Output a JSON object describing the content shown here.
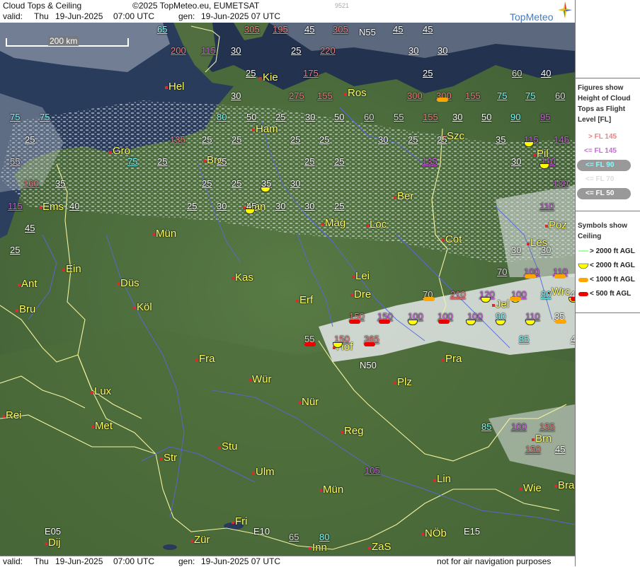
{
  "header": {
    "title": "Cloud Tops & Ceiling",
    "copyright": "©2025 TopMeteo.eu, EUMETSAT",
    "image_code": "9521",
    "valid_label": "valid:",
    "valid_day": "Thu",
    "valid_date": "19-Jun-2025",
    "valid_time": "07:00 UTC",
    "gen_label": "gen:",
    "gen_value": "19-Jun-2025 07 UTC",
    "logo_text": "TopMeteo"
  },
  "footer": {
    "valid_label": "valid:",
    "valid_day": "Thu",
    "valid_date": "19-Jun-2025",
    "valid_time": "07:00 UTC",
    "gen_label": "gen:",
    "gen_value": "19-Jun-2025 07 UTC",
    "disclaimer": "not for air navigation purposes"
  },
  "scale_bar": {
    "label": "200 km"
  },
  "legend": {
    "tops_title": "Figures show Height of Cloud Tops as Flight Level  [FL]",
    "tops_items": [
      {
        "label": "> FL 145",
        "color": "#f08080"
      },
      {
        "label": "<= FL 145",
        "color": "#cc66dd"
      },
      {
        "label": "<= FL 90",
        "color": "#80ffff"
      },
      {
        "label": "<= FL 70",
        "color": "#dddddd"
      },
      {
        "label": "<= FL 50",
        "color": "#ffffff"
      }
    ],
    "ceiling_title": "Symbols show Ceiling",
    "ceiling_items": [
      {
        "label": "> 2000 ft AGL",
        "color": "#88ff88",
        "shape": "line"
      },
      {
        "label": "< 2000 ft AGL",
        "color": "#ffff00",
        "shape": "half-circle"
      },
      {
        "label": "< 1000 ft AGL",
        "color": "#ffa500",
        "shape": "pill"
      },
      {
        "label": "< 500 ft AGL",
        "color": "#ee0000",
        "shape": "pill"
      }
    ]
  },
  "map": {
    "icon": "satellite-map",
    "cities": [
      "Hel",
      "Kie",
      "Ros",
      "Ham",
      "Gro",
      "Bre",
      "Szc",
      "Pil",
      "Ems",
      "Han",
      "Ber",
      "Poz",
      "Mag",
      "Loc",
      "Mün",
      "Cot",
      "Les",
      "Ein",
      "Kas",
      "Lei",
      "Ant",
      "Düs",
      "Dre",
      "Wrc",
      "Köl",
      "Erf",
      "Jel",
      "Bru",
      "Hof",
      "Pra",
      "Fra",
      "Lux",
      "Wür",
      "Plz",
      "Nür",
      "Rei",
      "Met",
      "Reg",
      "Brn",
      "Stu",
      "Str",
      "Ulm",
      "Lin",
      "Mün",
      "Wie",
      "Bra",
      "Fri",
      "Dij",
      "Zür",
      "Inn",
      "ZaS",
      "NÖb"
    ],
    "grid_labels": [
      "N55",
      "N50",
      "E05",
      "E10",
      "E15"
    ],
    "cloud_tops": [
      {
        "v": "65",
        "c": "#80ffff"
      },
      {
        "v": "305",
        "c": "#f08080"
      },
      {
        "v": "195",
        "c": "#f08080"
      },
      {
        "v": "45",
        "c": "#ffffff"
      },
      {
        "v": "305",
        "c": "#f08080"
      },
      {
        "v": "45",
        "c": "#ffffff"
      },
      {
        "v": "45",
        "c": "#ffffff"
      },
      {
        "v": "200",
        "c": "#f08080"
      },
      {
        "v": "115",
        "c": "#cc66dd"
      },
      {
        "v": "30",
        "c": "#ffffff"
      },
      {
        "v": "25",
        "c": "#ffffff"
      },
      {
        "v": "220",
        "c": "#f08080"
      },
      {
        "v": "30",
        "c": "#ffffff"
      },
      {
        "v": "30",
        "c": "#ffffff"
      },
      {
        "v": "25",
        "c": "#ffffff"
      },
      {
        "v": "175",
        "c": "#f08080"
      },
      {
        "v": "25",
        "c": "#ffffff"
      },
      {
        "v": "60",
        "c": "#dddddd"
      },
      {
        "v": "40",
        "c": "#ffffff"
      },
      {
        "v": "30",
        "c": "#ffffff"
      },
      {
        "v": "275",
        "c": "#f08080"
      },
      {
        "v": "155",
        "c": "#f08080"
      },
      {
        "v": "300",
        "c": "#f08080"
      },
      {
        "v": "300",
        "c": "#f08080"
      },
      {
        "v": "155",
        "c": "#f08080"
      },
      {
        "v": "75",
        "c": "#80ffff"
      },
      {
        "v": "75",
        "c": "#80ffff"
      },
      {
        "v": "60",
        "c": "#dddddd"
      },
      {
        "v": "75",
        "c": "#80ffff"
      },
      {
        "v": "75",
        "c": "#80ffff"
      },
      {
        "v": "80",
        "c": "#80ffff"
      },
      {
        "v": "50",
        "c": "#ffffff"
      },
      {
        "v": "25",
        "c": "#ffffff"
      },
      {
        "v": "30",
        "c": "#ffffff"
      },
      {
        "v": "50",
        "c": "#ffffff"
      },
      {
        "v": "60",
        "c": "#dddddd"
      },
      {
        "v": "55",
        "c": "#dddddd"
      },
      {
        "v": "155",
        "c": "#f08080"
      },
      {
        "v": "30",
        "c": "#ffffff"
      },
      {
        "v": "50",
        "c": "#ffffff"
      },
      {
        "v": "90",
        "c": "#80ffff"
      },
      {
        "v": "95",
        "c": "#cc66dd"
      },
      {
        "v": "25",
        "c": "#ffffff"
      },
      {
        "v": "135",
        "c": "#f08080"
      },
      {
        "v": "25",
        "c": "#ffffff"
      },
      {
        "v": "25",
        "c": "#ffffff"
      },
      {
        "v": "25",
        "c": "#ffffff"
      },
      {
        "v": "25",
        "c": "#ffffff"
      },
      {
        "v": "30",
        "c": "#ffffff"
      },
      {
        "v": "25",
        "c": "#ffffff"
      },
      {
        "v": "25",
        "c": "#ffffff"
      },
      {
        "v": "35",
        "c": "#ffffff"
      },
      {
        "v": "115",
        "c": "#cc66dd"
      },
      {
        "v": "145",
        "c": "#cc66dd"
      },
      {
        "v": "55",
        "c": "#dddddd"
      },
      {
        "v": "75",
        "c": "#80ffff"
      },
      {
        "v": "25",
        "c": "#ffffff"
      },
      {
        "v": "25",
        "c": "#ffffff"
      },
      {
        "v": "25",
        "c": "#ffffff"
      },
      {
        "v": "25",
        "c": "#ffffff"
      },
      {
        "v": "135",
        "c": "#cc66dd"
      },
      {
        "v": "30",
        "c": "#ffffff"
      },
      {
        "v": "110",
        "c": "#cc66dd"
      },
      {
        "v": "160",
        "c": "#f08080"
      },
      {
        "v": "35",
        "c": "#ffffff"
      },
      {
        "v": "25",
        "c": "#ffffff"
      },
      {
        "v": "25",
        "c": "#ffffff"
      },
      {
        "v": "35",
        "c": "#ffffff"
      },
      {
        "v": "30",
        "c": "#ffffff"
      },
      {
        "v": "120",
        "c": "#cc66dd"
      },
      {
        "v": "115",
        "c": "#cc66dd"
      },
      {
        "v": "40",
        "c": "#ffffff"
      },
      {
        "v": "25",
        "c": "#ffffff"
      },
      {
        "v": "30",
        "c": "#ffffff"
      },
      {
        "v": "45",
        "c": "#ffffff"
      },
      {
        "v": "30",
        "c": "#ffffff"
      },
      {
        "v": "30",
        "c": "#ffffff"
      },
      {
        "v": "25",
        "c": "#ffffff"
      },
      {
        "v": "110",
        "c": "#cc66dd"
      },
      {
        "v": "45",
        "c": "#ffffff"
      },
      {
        "v": "25",
        "c": "#ffffff"
      },
      {
        "v": "30",
        "c": "#ffffff"
      },
      {
        "v": "30",
        "c": "#ffffff"
      },
      {
        "v": "70",
        "c": "#dddddd"
      },
      {
        "v": "100",
        "c": "#cc66dd"
      },
      {
        "v": "110",
        "c": "#cc66dd"
      },
      {
        "v": "70",
        "c": "#dddddd"
      },
      {
        "v": "210",
        "c": "#f08080"
      },
      {
        "v": "120",
        "c": "#cc66dd"
      },
      {
        "v": "100",
        "c": "#cc66dd"
      },
      {
        "v": "80",
        "c": "#80ffff"
      },
      {
        "v": "45",
        "c": "#ffffff"
      },
      {
        "v": "150",
        "c": "#f08080"
      },
      {
        "v": "150",
        "c": "#cc66dd"
      },
      {
        "v": "100",
        "c": "#cc66dd"
      },
      {
        "v": "100",
        "c": "#cc66dd"
      },
      {
        "v": "100",
        "c": "#cc66dd"
      },
      {
        "v": "90",
        "c": "#80ffff"
      },
      {
        "v": "110",
        "c": "#cc66dd"
      },
      {
        "v": "35",
        "c": "#ffffff"
      },
      {
        "v": "55",
        "c": "#dddddd"
      },
      {
        "v": "150",
        "c": "#f08080"
      },
      {
        "v": "365",
        "c": "#f08080"
      },
      {
        "v": "85",
        "c": "#80ffff"
      },
      {
        "v": "45",
        "c": "#ffffff"
      },
      {
        "v": "85",
        "c": "#80ffff"
      },
      {
        "v": "100",
        "c": "#cc66dd"
      },
      {
        "v": "155",
        "c": "#f08080"
      },
      {
        "v": "150",
        "c": "#f08080"
      },
      {
        "v": "45",
        "c": "#ffffff"
      },
      {
        "v": "105",
        "c": "#cc66dd"
      },
      {
        "v": "65",
        "c": "#dddddd"
      },
      {
        "v": "80",
        "c": "#80ffff"
      }
    ],
    "ceiling_symbols": [
      "yellow",
      "yellow",
      "yellow",
      "yellow",
      "orange",
      "orange",
      "yellow",
      "yellow",
      "orange",
      "red",
      "red",
      "orange",
      "red",
      "yellow",
      "yellow",
      "yellow",
      "yellow",
      "yellow",
      "orange",
      "red",
      "red",
      "yellow",
      "red",
      "orange"
    ]
  }
}
